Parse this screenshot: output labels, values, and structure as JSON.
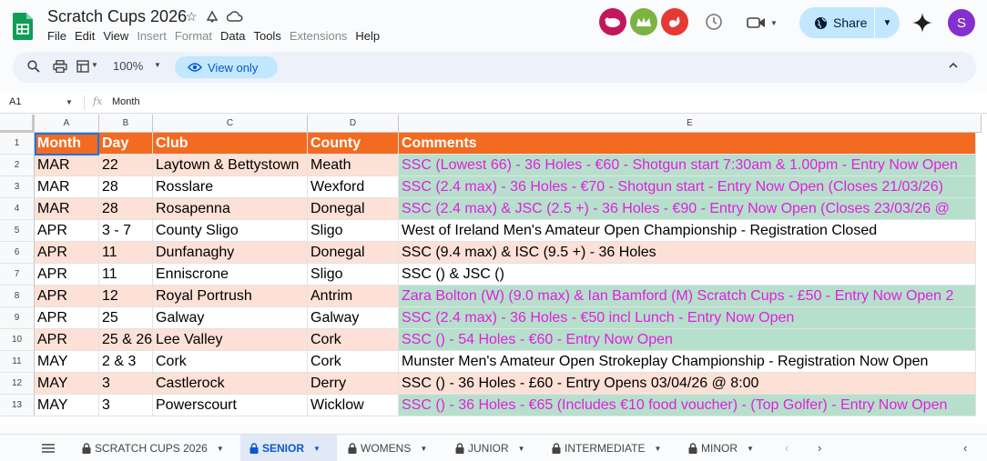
{
  "app": {
    "title": "Scratch Cups 2026",
    "menu": [
      {
        "label": "File",
        "enabled": true
      },
      {
        "label": "Edit",
        "enabled": true
      },
      {
        "label": "View",
        "enabled": true
      },
      {
        "label": "Insert",
        "enabled": false
      },
      {
        "label": "Format",
        "enabled": false
      },
      {
        "label": "Data",
        "enabled": true
      },
      {
        "label": "Tools",
        "enabled": true
      },
      {
        "label": "Extensions",
        "enabled": false
      },
      {
        "label": "Help",
        "enabled": true
      }
    ],
    "share_label": "Share",
    "user_initial": "S"
  },
  "toolbar": {
    "zoom": "100%",
    "view_only_label": "View only"
  },
  "formula": {
    "cell_ref": "A1",
    "fx": "fx",
    "content": "Month"
  },
  "grid": {
    "columns": [
      "A",
      "B",
      "C",
      "D",
      "E"
    ],
    "header": [
      "Month",
      "Day",
      "Club",
      "County",
      "Comments"
    ],
    "rows": [
      {
        "n": "2",
        "month": "MAR",
        "day": "22",
        "club": "Laytown & Bettystown",
        "county": "Meath",
        "comment": "SSC (Lowest 66) - 36 Holes - €60 - Shotgun start 7:30am & 1.00pm - Entry Now Open",
        "style": "open"
      },
      {
        "n": "3",
        "month": "MAR",
        "day": "28",
        "club": "Rosslare",
        "county": "Wexford",
        "comment": "SSC (2.4 max) - 36 Holes - €70 -  Shotgun start - Entry Now Open (Closes 21/03/26)",
        "style": "open"
      },
      {
        "n": "4",
        "month": "MAR",
        "day": "28",
        "club": "Rosapenna",
        "county": "Donegal",
        "comment": "SSC (2.4 max) & JSC (2.5 +) - 36 Holes - €90 - Entry Now Open  (Closes 23/03/26 @",
        "style": "open"
      },
      {
        "n": "5",
        "month": "APR",
        "day": "3 - 7",
        "club": "County Sligo",
        "county": "Sligo",
        "comment": "West of Ireland Men's Amateur Open Championship - Registration Closed",
        "style": "plain"
      },
      {
        "n": "6",
        "month": "APR",
        "day": "11",
        "club": "Dunfanaghy",
        "county": "Donegal",
        "comment": "SSC (9.4 max) & ISC (9.5 +) - 36 Holes",
        "style": "plain"
      },
      {
        "n": "7",
        "month": "APR",
        "day": "11",
        "club": "Enniscrone",
        "county": "Sligo",
        "comment": "SSC () & JSC ()",
        "style": "plain"
      },
      {
        "n": "8",
        "month": "APR",
        "day": "12",
        "club": "Royal Portrush",
        "county": "Antrim",
        "comment": "Zara Bolton (W) (9.0 max) & Ian Bamford (M) Scratch Cups - £50 - Entry Now Open 2",
        "style": "open"
      },
      {
        "n": "9",
        "month": "APR",
        "day": "25",
        "club": "Galway",
        "county": "Galway",
        "comment": "SSC (2.4 max) - 36 Holes - €50 incl Lunch - Entry Now Open",
        "style": "open"
      },
      {
        "n": "10",
        "month": "APR",
        "day": "25 & 26",
        "club": "Lee Valley",
        "county": "Cork",
        "comment": "SSC () - 54 Holes - €60 - Entry Now Open",
        "style": "open"
      },
      {
        "n": "11",
        "month": "MAY",
        "day": "2 & 3",
        "club": "Cork",
        "county": "Cork",
        "comment": "Munster Men's Amateur Open Strokeplay Championship - Registration Now Open",
        "style": "plain"
      },
      {
        "n": "12",
        "month": "MAY",
        "day": "3",
        "club": "Castlerock",
        "county": "Derry",
        "comment": "SSC () - 36 Holes - £60 - Entry Opens 03/04/26 @ 8:00",
        "style": "plain"
      },
      {
        "n": "13",
        "month": "MAY",
        "day": "3",
        "club": "Powerscourt",
        "county": "Wicklow",
        "comment": "SSC () - 36 Holes - €65 (Includes €10 food voucher) - (Top Golfer) - Entry Now Open",
        "style": "open"
      }
    ]
  },
  "tabs": [
    {
      "label": "SCRATCH CUPS 2026",
      "active": false
    },
    {
      "label": "SENIOR",
      "active": true
    },
    {
      "label": "WOMENS",
      "active": false
    },
    {
      "label": "JUNIOR",
      "active": false
    },
    {
      "label": "INTERMEDIATE",
      "active": false
    },
    {
      "label": "MINOR",
      "active": false
    }
  ],
  "colors": {
    "header_bg": "#f26b21",
    "row_alt": "#fde1d6",
    "open_bg": "#b6e0cc",
    "open_text": "#e21fe0",
    "accent": "#0b57d0"
  }
}
